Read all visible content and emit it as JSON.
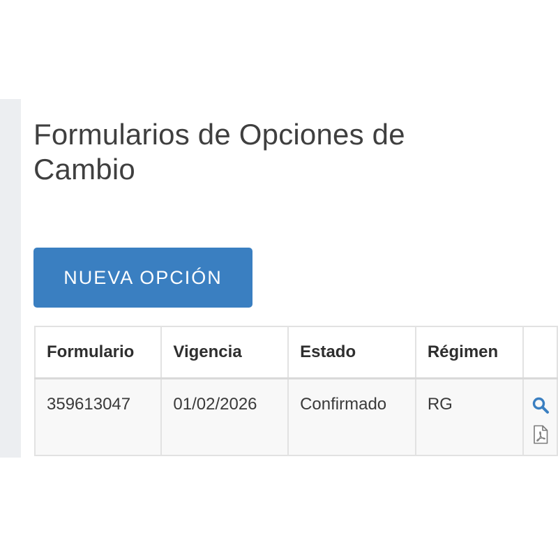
{
  "page": {
    "title": "Formularios de Opciones de Cambio"
  },
  "toolbar": {
    "new_option_label": "NUEVA OPCIÓN"
  },
  "table": {
    "headers": [
      "Formulario",
      "Vigencia",
      "Estado",
      "Régimen",
      ""
    ],
    "rows": [
      {
        "formulario": "359613047",
        "vigencia": "01/02/2026",
        "estado": "Confirmado",
        "regimen": "RG",
        "actions": [
          "search-icon",
          "pdf-icon"
        ]
      }
    ]
  },
  "colors": {
    "accent": "#3a7fc1",
    "text": "#3f3f3f",
    "border": "#e2e2e2",
    "row_bg": "#f8f8f8"
  }
}
